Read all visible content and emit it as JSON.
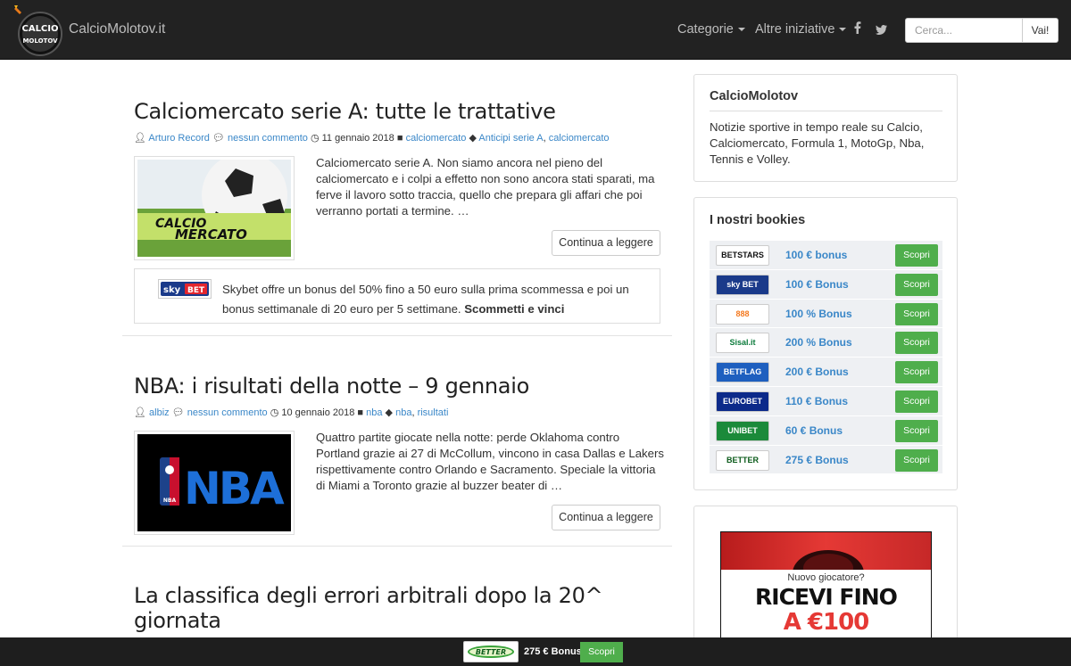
{
  "header": {
    "logo_text": [
      "CALCIO",
      "MOLOTOV"
    ],
    "brand": "CalcioMolotov.it",
    "nav": [
      {
        "label": "Categorie",
        "dropdown": true
      },
      {
        "label": "Altre iniziative",
        "dropdown": true
      }
    ],
    "social": {
      "facebook": "f",
      "twitter": "t"
    },
    "search": {
      "placeholder": "Cerca...",
      "button": "Vai!"
    }
  },
  "posts": [
    {
      "title": "Calciomercato serie A: tutte le trattative",
      "author": "Arturo Record",
      "comments": "nessun commento",
      "date": "11 gennaio 2018",
      "category": "calciomercato",
      "tags": [
        "Anticipi serie A",
        "calciomercato"
      ],
      "thumb_text": [
        "CALCIO",
        "MERCATO"
      ],
      "excerpt": "Calciomercato serie A. Non siamo ancora nel pieno del calciomercato e i colpi a effetto non sono ancora stati sparati, ma ferve il lavoro sotto traccia, quello che prepara gli affari che poi verranno portati a termine. …",
      "read_more": "Continua a leggere"
    },
    {
      "title": "NBA: i risultati della notte – 9 gennaio",
      "author": "albiz",
      "comments": "nessun commento",
      "date": "10 gennaio 2018",
      "category": "nba",
      "tags": [
        "nba",
        "risultati"
      ],
      "thumb_text": [
        "NBA",
        "NBA"
      ],
      "excerpt": "Quattro partite giocate nella notte: perde Oklahoma contro Portland grazie ai 27 di McCollum, vincono in casa Dallas e Lakers rispettivamente contro Orlando e Sacramento. Speciale la vittoria di Miami a Toronto grazie al buzzer beater di …",
      "read_more": "Continua a leggere"
    },
    {
      "title_line1": "La classifica degli errori arbitrali dopo la 20^",
      "title_line2": "giornata"
    }
  ],
  "promo": {
    "logo_text": [
      "sky",
      "BET"
    ],
    "text": "Skybet offre un bonus del 50% fino a 50 euro sulla prima scommessa e poi un bonus settimanale di 20 euro per 5 settimane.",
    "cta": "Scommetti e vinci"
  },
  "sidebar": {
    "about": {
      "title": "CalcioMolotov",
      "text": "Notizie sportive in tempo reale su Calcio, Calciomercato, Formula 1, MotoGp, Nba, Tennis e Volley."
    },
    "bookies": {
      "title": "I nostri bookies",
      "items": [
        {
          "name": "BETSTARS",
          "bonus": "100 € bonus",
          "button": "Scopri",
          "logo_color": "#111",
          "logo_bg": "#fff"
        },
        {
          "name": "sky BET",
          "bonus": "100 € Bonus",
          "button": "Scopri",
          "logo_color": "#fff",
          "logo_bg": "#1a3a8a"
        },
        {
          "name": "888",
          "bonus": "100 % Bonus",
          "button": "Scopri",
          "logo_color": "#f47920",
          "logo_bg": "#fff"
        },
        {
          "name": "Sisal.it",
          "bonus": "200 % Bonus",
          "button": "Scopri",
          "logo_color": "#0a7a3a",
          "logo_bg": "#fff"
        },
        {
          "name": "BETFLAG",
          "bonus": "200 € Bonus",
          "button": "Scopri",
          "logo_color": "#fff",
          "logo_bg": "#1e5fbf"
        },
        {
          "name": "EUROBET",
          "bonus": "110 € Bonus",
          "button": "Scopri",
          "logo_color": "#fff",
          "logo_bg": "#0c2a8a"
        },
        {
          "name": "UNIBET",
          "bonus": "60 € Bonus",
          "button": "Scopri",
          "logo_color": "#fff",
          "logo_bg": "#1b8a3a"
        },
        {
          "name": "BETTER",
          "bonus": "275 € Bonus",
          "button": "Scopri",
          "logo_color": "#0a5a1a",
          "logo_bg": "#fff"
        }
      ]
    },
    "ad": {
      "line1": "Nuovo giocatore?",
      "line2": "RICEVI FINO",
      "line3": "A €100"
    }
  },
  "sticky_bar": {
    "logo_text": "BETTER",
    "bonus": "275 € Bonus",
    "button": "Scopri"
  },
  "colors": {
    "navbar": "#222222",
    "link": "#3a87c8",
    "scopri_button": "#4fae4c"
  }
}
